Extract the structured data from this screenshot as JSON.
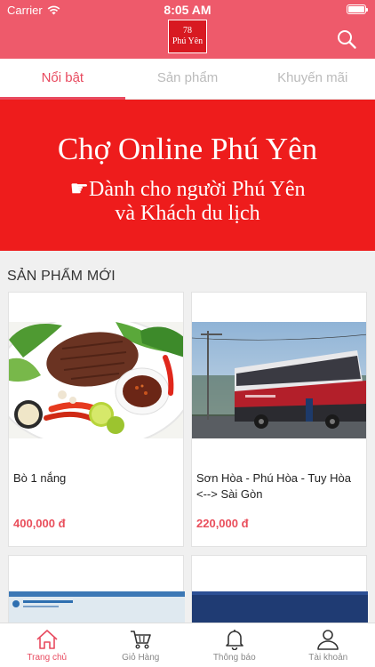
{
  "status_bar": {
    "carrier": "Carrier",
    "time": "8:05 AM"
  },
  "header": {
    "logo_line1": "78",
    "logo_line2": "Phú Yên"
  },
  "tabs": [
    {
      "label": "Nổi bật",
      "active": true
    },
    {
      "label": "Sản phẩm",
      "active": false
    },
    {
      "label": "Khuyến mãi",
      "active": false
    }
  ],
  "banner": {
    "title": "Chợ Online Phú Yên",
    "line1": "☛Dành cho người Phú Yên",
    "line2": "và Khách du lịch"
  },
  "section": {
    "title": "SẢN PHẨM MỚI"
  },
  "products": [
    {
      "name": "Bò 1 nắng",
      "price": "400,000 đ"
    },
    {
      "name": "Sơn Hòa - Phú Hòa - Tuy Hòa <--> Sài Gòn",
      "price": "220,000 đ"
    }
  ],
  "bottom_tabs": [
    {
      "label": "Trang chủ",
      "icon": "home-icon",
      "active": true
    },
    {
      "label": "Giỏ Hàng",
      "icon": "cart-icon",
      "active": false
    },
    {
      "label": "Thông báo",
      "icon": "bell-icon",
      "active": false
    },
    {
      "label": "Tài khoản",
      "icon": "user-icon",
      "active": false
    }
  ],
  "colors": {
    "brand": "#ee5a6b",
    "accent": "#e84a5f",
    "banner": "#ee1c1c",
    "price": "#e94e5b"
  }
}
